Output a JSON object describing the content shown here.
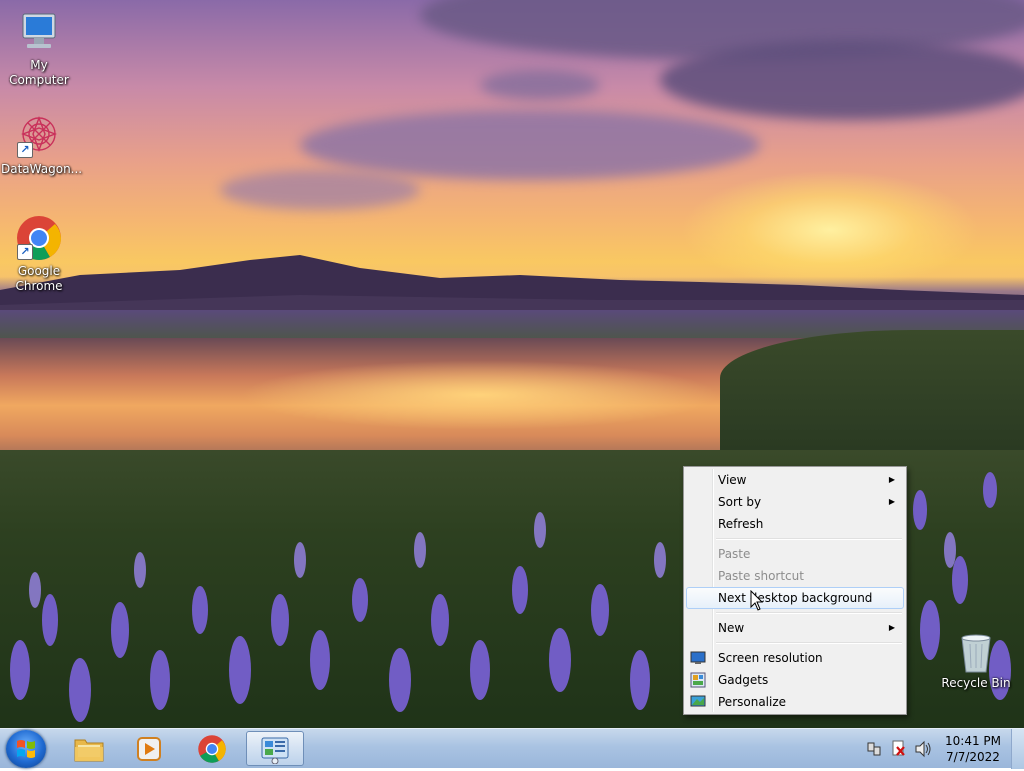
{
  "desktop": {
    "icons": [
      {
        "label": "My Computer",
        "icon": "computer-icon"
      },
      {
        "label": "DataWagon...",
        "icon": "datawagon-icon"
      },
      {
        "label": "Google Chrome",
        "icon": "chrome-icon"
      },
      {
        "label": "Recycle Bin",
        "icon": "recycle-bin-icon"
      }
    ]
  },
  "context_menu": {
    "items": [
      {
        "label": "View",
        "submenu": true,
        "enabled": true
      },
      {
        "label": "Sort by",
        "submenu": true,
        "enabled": true
      },
      {
        "label": "Refresh",
        "enabled": true
      },
      {
        "label": "Paste",
        "enabled": false
      },
      {
        "label": "Paste shortcut",
        "enabled": false
      },
      {
        "label": "Next desktop background",
        "enabled": true,
        "highlighted": true
      },
      {
        "label": "New",
        "submenu": true,
        "enabled": true
      },
      {
        "label": "Screen resolution",
        "icon": "screen-resolution-icon",
        "enabled": true
      },
      {
        "label": "Gadgets",
        "icon": "gadgets-icon",
        "enabled": true
      },
      {
        "label": "Personalize",
        "icon": "personalize-icon",
        "enabled": true
      }
    ],
    "submenu_arrow": "▶"
  },
  "taskbar": {
    "pinned": [
      {
        "name": "file-explorer",
        "icon": "folder-icon"
      },
      {
        "name": "media-player",
        "icon": "media-player-icon"
      },
      {
        "name": "chrome",
        "icon": "chrome-icon"
      },
      {
        "name": "control-panel",
        "icon": "control-panel-icon",
        "active": true
      }
    ],
    "tray": {
      "icons": [
        "network-icon",
        "action-center-icon",
        "volume-icon"
      ],
      "time": "10:41 PM",
      "date": "7/7/2022"
    }
  },
  "colors": {
    "menu_bg": "#f0f0f0",
    "menu_highlight_border": "#aecff7",
    "disabled_text": "#8d8d8d",
    "taskbar": "#a9c3e2"
  }
}
